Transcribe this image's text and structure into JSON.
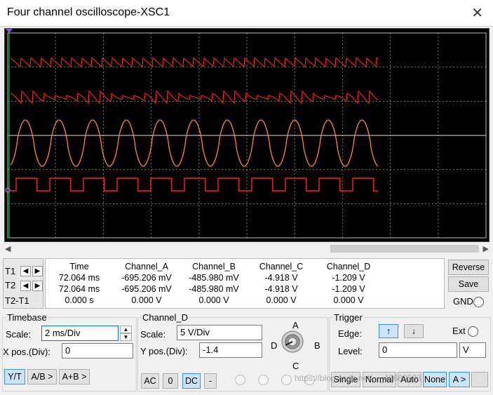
{
  "window": {
    "title": "Four channel oscilloscope-XSC1",
    "close_glyph": "✕"
  },
  "readout": {
    "row_labels": [
      "T1",
      "T2",
      "T2-T1"
    ],
    "headers": [
      "Time",
      "Channel_A",
      "Channel_B",
      "Channel_C",
      "Channel_D"
    ],
    "rows": [
      [
        "72.064 ms",
        "-695.206 mV",
        "-485.980 mV",
        "-4.918 V",
        "-1.209 V"
      ],
      [
        "72.064 ms",
        "-695.206 mV",
        "-485.980 mV",
        "-4.918 V",
        "-1.209 V"
      ],
      [
        "0.000 s",
        "0.000 V",
        "0.000 V",
        "0.000 V",
        "0.000 V"
      ]
    ]
  },
  "side_buttons": {
    "reverse": "Reverse",
    "save": "Save",
    "gnd": "GND"
  },
  "timebase": {
    "title": "Timebase",
    "scale_label": "Scale:",
    "scale_value": "2 ms/Div",
    "xpos_label": "X pos.(Div):",
    "xpos_value": "0",
    "modes": [
      "Y/T",
      "A/B >",
      "A+B >"
    ]
  },
  "channel": {
    "title": "Channel_D",
    "scale_label": "Scale:",
    "scale_value": "5  V/Div",
    "ypos_label": "Y pos.(Div):",
    "ypos_value": "-1.4",
    "coupling": [
      "AC",
      "0",
      "DC",
      "-"
    ],
    "knob_labels": {
      "a": "A",
      "b": "B",
      "c": "C",
      "d": "D"
    }
  },
  "trigger": {
    "title": "Trigger",
    "edge_label": "Edge:",
    "ext_label": "Ext",
    "level_label": "Level:",
    "level_value": "0",
    "level_unit": "V",
    "modes": [
      "Single",
      "Normal",
      "Auto",
      "None",
      "A >"
    ],
    "rising_glyph": "↑",
    "falling_glyph": "↓"
  },
  "watermark": "https://blog.csdn.net/..._45689593",
  "colors": {
    "trace_red": "#ff2020",
    "trace_orange": "#ff8c1a",
    "grid": "#8a8a8a",
    "screen_bg": "#000000",
    "cursor": "#00cc00"
  }
}
